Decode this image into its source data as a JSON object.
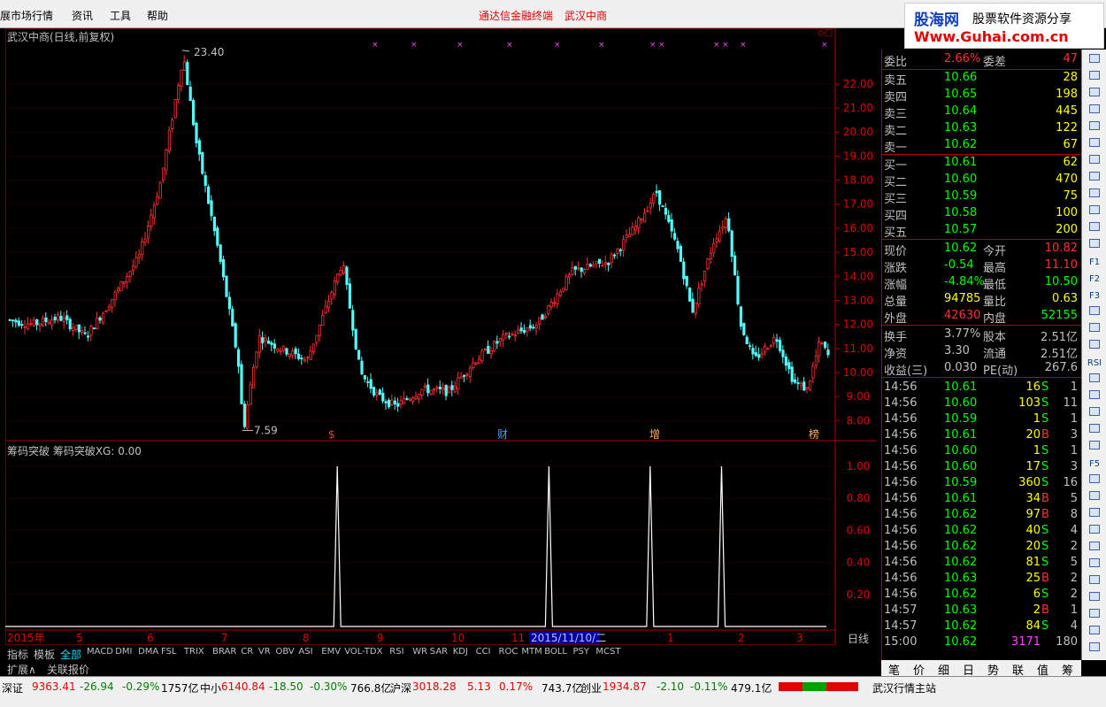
{
  "menu": {
    "item0": "展市场行情",
    "item1": "资讯",
    "item2": "工具",
    "item3": "帮助",
    "title_left": "通达信金融终端",
    "title_right": "武汉中商"
  },
  "logo": {
    "name": "股海网",
    "slogan": "股票软件资源分享",
    "url": "Www.Guhai.com.cn"
  },
  "chart": {
    "title": "武汉中商(日线,前复权)",
    "high_label": "23.40",
    "low_label": "7.59",
    "indicator_title": "筹码突破  筹码突破XG: 0.00",
    "period": "日线",
    "price_ticks": [
      "22.00",
      "21.00",
      "20.00",
      "19.00",
      "18.00",
      "17.00",
      "16.00",
      "15.00",
      "14.00",
      "13.00",
      "12.00",
      "11.00",
      "10.00",
      "9.00",
      "8.00"
    ],
    "ind_ticks": [
      "1.00",
      "0.80",
      "0.60",
      "0.40",
      "0.20"
    ],
    "date_labels": [
      "2015年",
      "5",
      "6",
      "7",
      "8",
      "9",
      "10",
      "11",
      "2015/11/10/二",
      "1",
      "2",
      "3"
    ],
    "markers": [
      "$",
      "财",
      "增",
      "榜"
    ],
    "ctrl": [
      "+",
      "-",
      "0"
    ]
  },
  "chart_data": {
    "type": "candlestick",
    "ylim": [
      7.2,
      23.8
    ],
    "high": 23.4,
    "low": 7.59,
    "indicator": {
      "name": "筹码突破XG",
      "value": 0.0,
      "ylim": [
        0,
        1.05
      ],
      "spikes_at_fraction": [
        0.4,
        0.655,
        0.777,
        0.863
      ]
    }
  },
  "quote": {
    "weibi": {
      "l": "委比",
      "v": "2.66%",
      "l2": "委差",
      "n": "47"
    },
    "sell": [
      {
        "l": "卖五",
        "p": "10.66",
        "n": "28"
      },
      {
        "l": "卖四",
        "p": "10.65",
        "n": "198"
      },
      {
        "l": "卖三",
        "p": "10.64",
        "n": "445"
      },
      {
        "l": "卖二",
        "p": "10.63",
        "n": "122"
      },
      {
        "l": "卖一",
        "p": "10.62",
        "n": "67"
      }
    ],
    "buy": [
      {
        "l": "买一",
        "p": "10.61",
        "n": "62"
      },
      {
        "l": "买二",
        "p": "10.60",
        "n": "470"
      },
      {
        "l": "买三",
        "p": "10.59",
        "n": "75"
      },
      {
        "l": "买四",
        "p": "10.58",
        "n": "100"
      },
      {
        "l": "买五",
        "p": "10.57",
        "n": "200"
      }
    ],
    "stats": [
      {
        "l": "现价",
        "v": "10.62",
        "l2": "今开",
        "n": "10.82",
        "c1": "g",
        "c2": "r"
      },
      {
        "l": "涨跌",
        "v": "-0.54",
        "l2": "最高",
        "n": "11.10",
        "c1": "g",
        "c2": "r"
      },
      {
        "l": "涨幅",
        "v": "-4.84%",
        "l2": "最低",
        "n": "10.50",
        "c1": "g",
        "c2": "g"
      },
      {
        "l": "总量",
        "v": "94785",
        "l2": "量比",
        "n": "0.63",
        "c1": "y",
        "c2": "y"
      },
      {
        "l": "外盘",
        "v": "42630",
        "l2": "内盘",
        "n": "52155",
        "c1": "r",
        "c2": "g"
      }
    ],
    "info": [
      {
        "l": "换手",
        "v": "3.77%",
        "l2": "股本",
        "n": "2.51亿"
      },
      {
        "l": "净资",
        "v": "3.30",
        "l2": "流通",
        "n": "2.51亿"
      },
      {
        "l": "收益(三)",
        "v": "0.030",
        "l2": "PE(动)",
        "n": "267.6"
      }
    ],
    "ticks": [
      {
        "t": "14:56",
        "p": "10.61",
        "v": "16",
        "bs": "S",
        "c": "1"
      },
      {
        "t": "14:56",
        "p": "10.60",
        "v": "103",
        "bs": "S",
        "c": "11"
      },
      {
        "t": "14:56",
        "p": "10.59",
        "v": "1",
        "bs": "S",
        "c": "1"
      },
      {
        "t": "14:56",
        "p": "10.61",
        "v": "20",
        "bs": "B",
        "c": "3"
      },
      {
        "t": "14:56",
        "p": "10.60",
        "v": "1",
        "bs": "S",
        "c": "1"
      },
      {
        "t": "14:56",
        "p": "10.60",
        "v": "17",
        "bs": "S",
        "c": "3"
      },
      {
        "t": "14:56",
        "p": "10.59",
        "v": "360",
        "bs": "S",
        "c": "16"
      },
      {
        "t": "14:56",
        "p": "10.61",
        "v": "34",
        "bs": "B",
        "c": "5"
      },
      {
        "t": "14:56",
        "p": "10.62",
        "v": "97",
        "bs": "B",
        "c": "8"
      },
      {
        "t": "14:56",
        "p": "10.62",
        "v": "40",
        "bs": "S",
        "c": "4"
      },
      {
        "t": "14:56",
        "p": "10.62",
        "v": "20",
        "bs": "S",
        "c": "2"
      },
      {
        "t": "14:56",
        "p": "10.62",
        "v": "81",
        "bs": "S",
        "c": "5"
      },
      {
        "t": "14:56",
        "p": "10.63",
        "v": "25",
        "bs": "B",
        "c": "2"
      },
      {
        "t": "14:56",
        "p": "10.62",
        "v": "6",
        "bs": "S",
        "c": "2"
      },
      {
        "t": "14:57",
        "p": "10.63",
        "v": "2",
        "bs": "B",
        "c": "1"
      },
      {
        "t": "14:57",
        "p": "10.62",
        "v": "84",
        "bs": "S",
        "c": "4"
      },
      {
        "t": "15:00",
        "p": "10.62",
        "v": "3171",
        "bs": "",
        "c": "180"
      }
    ]
  },
  "right_tabs": [
    "笔",
    "价",
    "细",
    "日",
    "势",
    "联",
    "值",
    "筹"
  ],
  "tabs1": [
    "指标",
    "模板",
    "全部",
    "MACD",
    "DMI",
    "DMA",
    "FSL",
    "TRIX",
    "BRAR",
    "CR",
    "VR",
    "OBV",
    "ASI",
    "EMV",
    "VOL-TDX",
    "RSI",
    "WR",
    "SAR",
    "KDJ",
    "CCI",
    "ROC",
    "MTM",
    "BOLL",
    "PSY",
    "MCST"
  ],
  "tabs2": [
    "扩展∧",
    "关联报价"
  ],
  "status": {
    "sz_label": "深证",
    "sz_val": "9363.41",
    "sz_chg": "-26.94",
    "sz_pct": "-0.29%",
    "sz_amt": "1757亿",
    "zx_label": "中小",
    "zx_val": "6140.84",
    "zx_chg": "-18.50",
    "zx_pct": "-0.30%",
    "zx_amt": "766.8亿",
    "hs_label": "沪深",
    "hs_val": "3018.28",
    "hs_chg": "5.13",
    "hs_pct": "0.17%",
    "hs_amt": "743.7亿",
    "cy_label": "创业",
    "cy_val": "1934.87",
    "cy_chg": "-2.10",
    "cy_pct": "-0.11%",
    "cy_amt": "479.1亿",
    "station": "武汉行情主站"
  },
  "rightbar_icons": [
    "F1",
    "F2",
    "F3",
    "F5",
    "RSI"
  ]
}
